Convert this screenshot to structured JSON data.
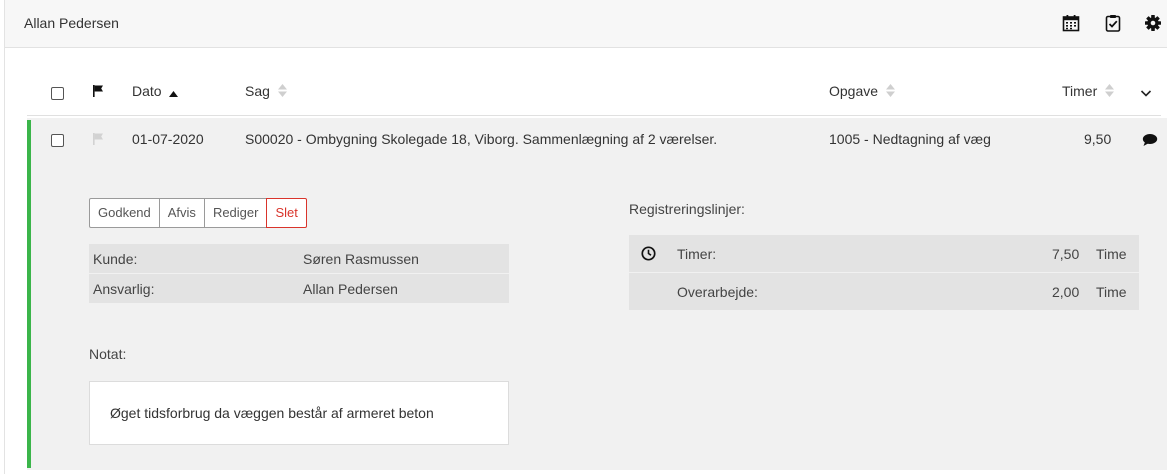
{
  "header": {
    "user_name": "Allan Pedersen",
    "icons": [
      "calendar-icon",
      "clipboard-check-icon",
      "gear-icon"
    ]
  },
  "table": {
    "columns": {
      "date": "Dato",
      "case": "Sag",
      "task": "Opgave",
      "hours": "Timer"
    },
    "sorted_column": "Dato",
    "sort_direction": "ascending",
    "row": {
      "date": "01-07-2020",
      "case": "S00020 - Ombygning Skolegade 18, Viborg. Sammenlægning af 2 værelser.",
      "task": "1005 - Nedtagning af væg",
      "hours": "9,50",
      "accent_color": "#3bb54a"
    }
  },
  "detail": {
    "actions": {
      "approve": "Godkend",
      "reject": "Afvis",
      "edit": "Rediger",
      "delete": "Slet"
    },
    "info": [
      {
        "label": "Kunde:",
        "value": "Søren Rasmussen"
      },
      {
        "label": "Ansvarlig:",
        "value": "Allan Pedersen"
      }
    ],
    "note_label": "Notat:",
    "note_text": "Øget tidsforbrug da væggen består af armeret beton",
    "registration_label": "Registreringslinjer:",
    "registration_lines": [
      {
        "label": "Timer:",
        "value": "7,50",
        "unit": "Time",
        "icon": "clock-icon"
      },
      {
        "label": "Overarbejde:",
        "value": "2,00",
        "unit": "Time",
        "icon": ""
      }
    ]
  },
  "colors": {
    "danger": "#d9342b",
    "accent": "#3bb54a"
  }
}
